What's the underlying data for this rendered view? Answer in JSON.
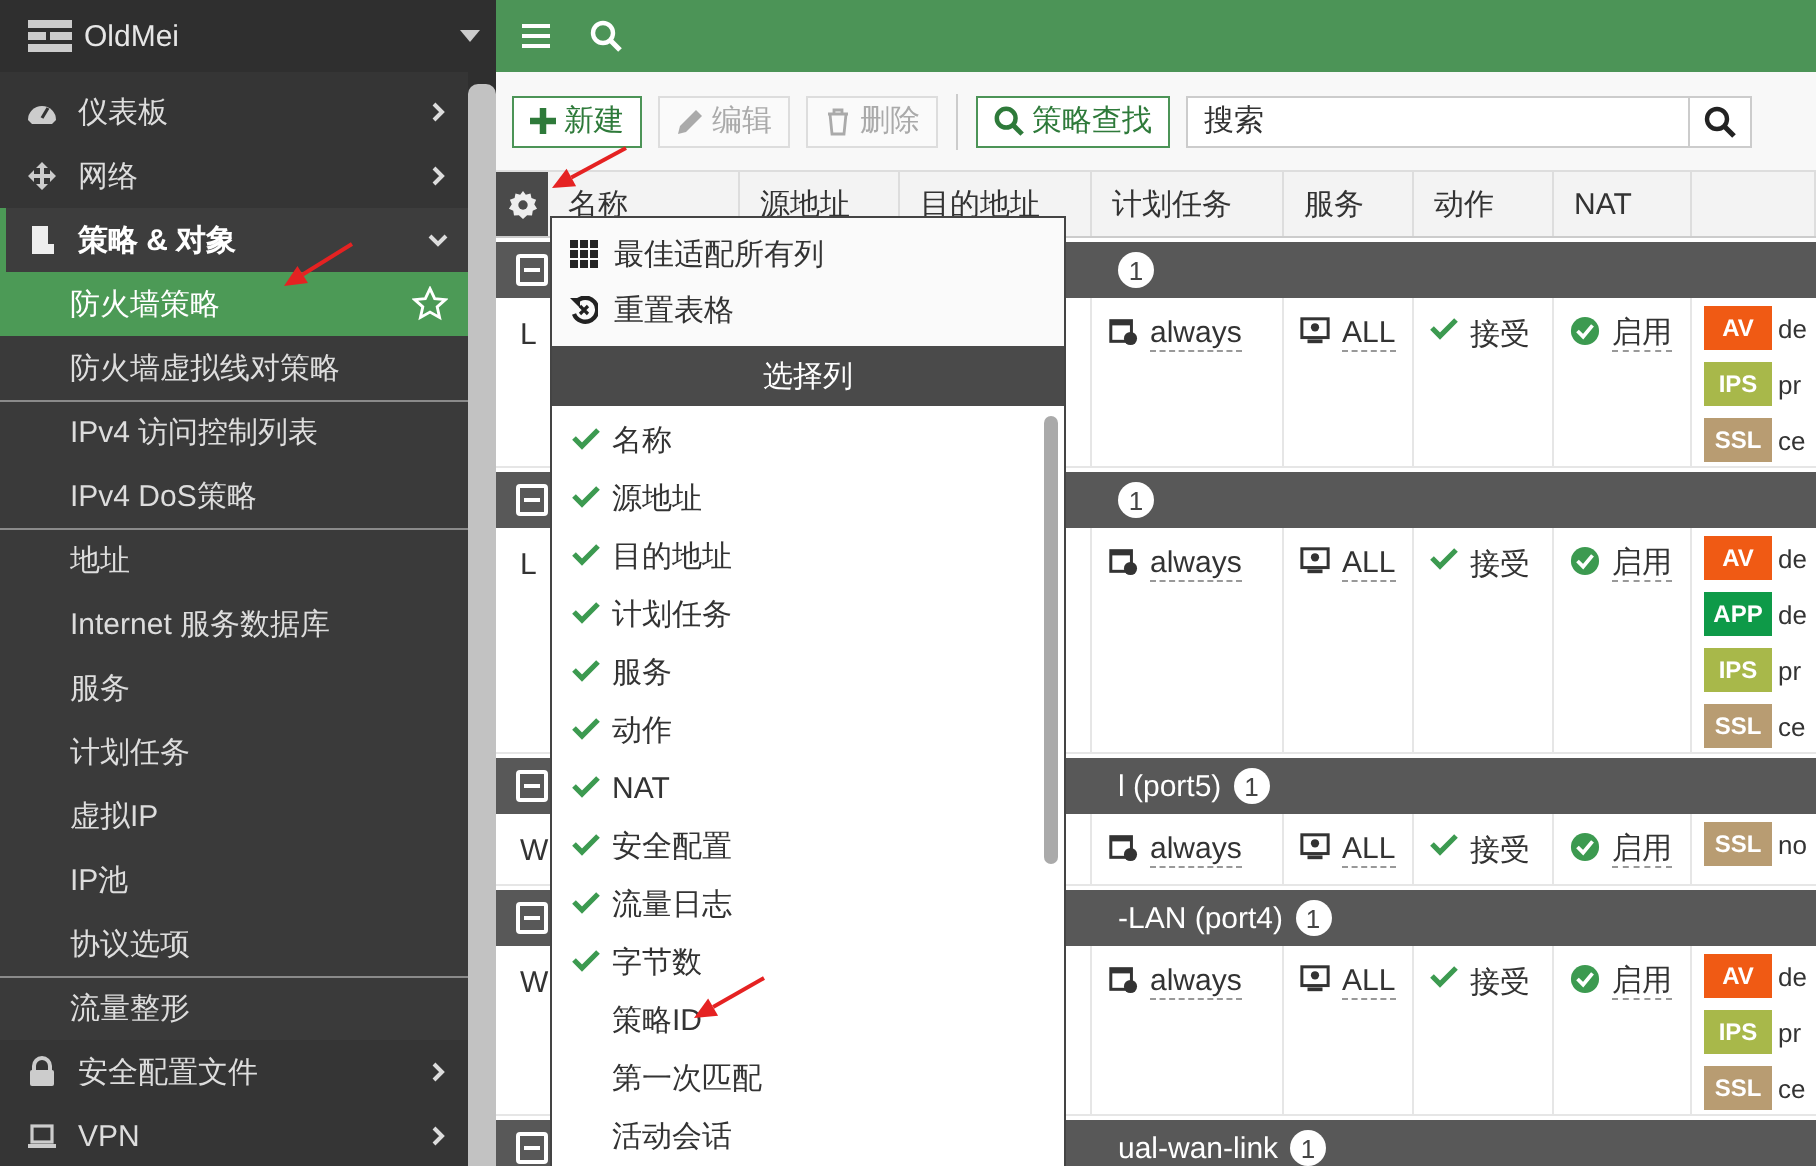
{
  "sidebar": {
    "brand": "OldMei",
    "items": [
      {
        "label": "仪表板",
        "expanded": false
      },
      {
        "label": "网络",
        "expanded": false
      },
      {
        "label": "策略 & 对象",
        "expanded": true,
        "children": [
          {
            "label": "防火墙策略",
            "selected": true,
            "separator_above": false
          },
          {
            "label": "防火墙虚拟线对策略",
            "selected": false,
            "separator_above": false
          },
          {
            "label": "IPv4 访问控制列表",
            "selected": false,
            "separator_above": true
          },
          {
            "label": "IPv4 DoS策略",
            "selected": false,
            "separator_above": false
          },
          {
            "label": "地址",
            "selected": false,
            "separator_above": true
          },
          {
            "label": "Internet 服务数据库",
            "selected": false,
            "separator_above": false
          },
          {
            "label": "服务",
            "selected": false,
            "separator_above": false
          },
          {
            "label": "计划任务",
            "selected": false,
            "separator_above": false
          },
          {
            "label": "虚拟IP",
            "selected": false,
            "separator_above": false
          },
          {
            "label": "IP池",
            "selected": false,
            "separator_above": false
          },
          {
            "label": "协议选项",
            "selected": false,
            "separator_above": false
          },
          {
            "label": "流量整形",
            "selected": false,
            "separator_above": true
          }
        ]
      },
      {
        "label": "安全配置文件",
        "expanded": false
      },
      {
        "label": "VPN",
        "expanded": false
      }
    ]
  },
  "toolbar": {
    "buttons": [
      {
        "label": "新建",
        "disabled": false
      },
      {
        "label": "编辑",
        "disabled": true
      },
      {
        "label": "删除",
        "disabled": true
      }
    ],
    "find_button": "策略查找",
    "search": {
      "placeholder": "搜索"
    }
  },
  "table": {
    "columns": [
      "名称",
      "源地址",
      "目的地址",
      "计划任务",
      "服务",
      "动作",
      "NAT"
    ],
    "groups": [
      {
        "expanded": true,
        "count": "1",
        "rows": [
          {
            "name": "L",
            "schedule": "always",
            "service": "ALL",
            "action": "接受",
            "nat": "启用",
            "profiles": [
              {
                "tag": "AV",
                "color": "#f05a14",
                "text": "de"
              },
              {
                "tag": "IPS",
                "color": "#a8b84a",
                "text": "pr"
              },
              {
                "tag": "SSL",
                "color": "#b89c72",
                "text": "ce"
              }
            ]
          }
        ]
      },
      {
        "expanded": true,
        "count": "1",
        "rows": [
          {
            "name": "L",
            "schedule": "always",
            "service": "ALL",
            "action": "接受",
            "nat": "启用",
            "profiles": [
              {
                "tag": "AV",
                "color": "#f05a14",
                "text": "de"
              },
              {
                "tag": "APP",
                "color": "#0e9a48",
                "text": "de"
              },
              {
                "tag": "IPS",
                "color": "#a8b84a",
                "text": "pr"
              },
              {
                "tag": "SSL",
                "color": "#b89c72",
                "text": "ce"
              }
            ]
          }
        ]
      },
      {
        "label": "l (port5)",
        "expanded": true,
        "count": "1",
        "rows": [
          {
            "name": "W",
            "schedule": "always",
            "service": "ALL",
            "action": "接受",
            "nat": "启用",
            "profiles": [
              {
                "tag": "SSL",
                "color": "#b89c72",
                "text": "no"
              }
            ]
          }
        ]
      },
      {
        "label": "-LAN (port4)",
        "expanded": true,
        "count": "1",
        "rows": [
          {
            "name": "W",
            "schedule": "always",
            "service": "ALL",
            "action": "接受",
            "nat": "启用",
            "profiles": [
              {
                "tag": "AV",
                "color": "#f05a14",
                "text": "de"
              },
              {
                "tag": "IPS",
                "color": "#a8b84a",
                "text": "pr"
              },
              {
                "tag": "SSL",
                "color": "#b89c72",
                "text": "ce"
              }
            ]
          }
        ]
      },
      {
        "label": "ual-wan-link",
        "expanded": true,
        "count": "1"
      }
    ]
  },
  "column_menu": {
    "actions": [
      "最佳适配所有列",
      "重置表格"
    ],
    "title": "选择列",
    "columns": [
      {
        "label": "名称",
        "checked": true
      },
      {
        "label": "源地址",
        "checked": true
      },
      {
        "label": "目的地址",
        "checked": true
      },
      {
        "label": "计划任务",
        "checked": true
      },
      {
        "label": "服务",
        "checked": true
      },
      {
        "label": "动作",
        "checked": true
      },
      {
        "label": "NAT",
        "checked": true
      },
      {
        "label": "安全配置",
        "checked": true
      },
      {
        "label": "流量日志",
        "checked": true
      },
      {
        "label": "字节数",
        "checked": true
      },
      {
        "label": "策略ID",
        "checked": false
      },
      {
        "label": "第一次匹配",
        "checked": false
      },
      {
        "label": "活动会话",
        "checked": false
      }
    ]
  }
}
